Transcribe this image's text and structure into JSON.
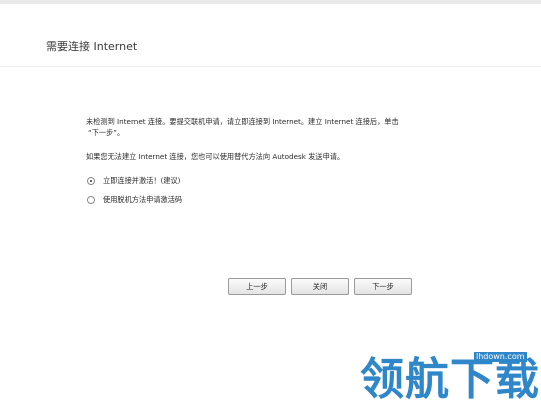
{
  "dialog": {
    "title": "需要连接 Internet"
  },
  "message": {
    "line1": "未检测到 Internet 连接。要提交联机申请，请立即连接到 Internet。建立 Internet 连接后，单击",
    "line1b": "“下一步”。",
    "line2": "如果您无法建立 Internet 连接，您也可以使用替代方法向 Autodesk 发送申请。"
  },
  "options": [
    {
      "label": "立即连接并激活！(建议)",
      "checked": true
    },
    {
      "label": "使用脱机方法申请激活码",
      "checked": false
    }
  ],
  "buttons": {
    "back": "上一步",
    "close": "关闭",
    "next": "下一步"
  },
  "watermark": {
    "url": "lhdown.com",
    "text": "领航下载"
  }
}
